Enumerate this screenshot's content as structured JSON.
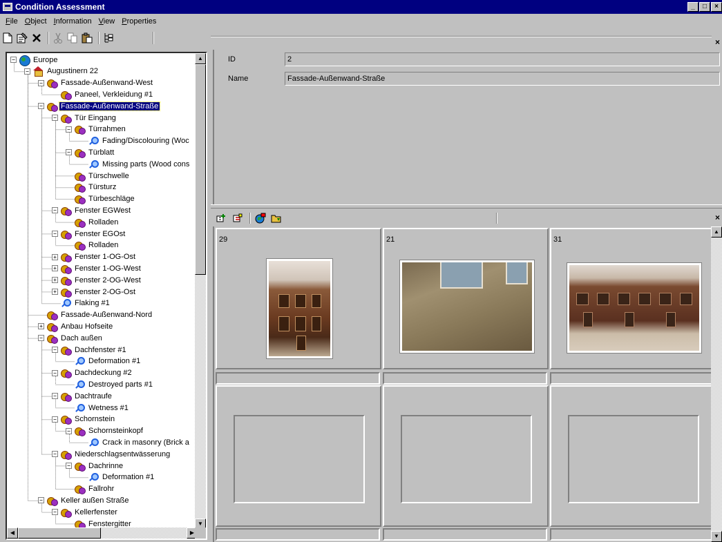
{
  "window": {
    "title": "Condition Assessment",
    "controls": {
      "minimize": "_",
      "maximize": "□",
      "close": "×"
    }
  },
  "menu": {
    "items": [
      {
        "accel": "F",
        "rest": "ile"
      },
      {
        "accel": "O",
        "rest": "bject"
      },
      {
        "accel": "I",
        "rest": "nformation"
      },
      {
        "accel": "V",
        "rest": "iew"
      },
      {
        "accel": "P",
        "rest": "roperties"
      }
    ]
  },
  "toolbar": {
    "icons": [
      "new-document-icon",
      "properties-icon",
      "delete-icon",
      "cut-icon",
      "copy-icon",
      "paste-icon",
      "tree-view-icon"
    ],
    "close_glyph": "×"
  },
  "tree": {
    "nodes": [
      {
        "label": "Europe",
        "depth": 0,
        "expander": "−",
        "icon": "globe-icon"
      },
      {
        "label": "Augustinern 22",
        "depth": 1,
        "expander": "−",
        "icon": "house-icon"
      },
      {
        "label": "Fassade-Außenwand-West",
        "depth": 2,
        "expander": "−",
        "icon": "component-icon"
      },
      {
        "label": "Paneel, Verkleidung #1",
        "depth": 3,
        "expander": "",
        "icon": "component-icon"
      },
      {
        "label": "Fassade-Außenwand-Straße",
        "depth": 2,
        "expander": "−",
        "icon": "component-icon",
        "selected": true
      },
      {
        "label": "Tür Eingang",
        "depth": 3,
        "expander": "−",
        "icon": "component-icon"
      },
      {
        "label": "Türrahmen",
        "depth": 4,
        "expander": "−",
        "icon": "component-icon"
      },
      {
        "label": "Fading/Discolouring (Woc",
        "depth": 5,
        "expander": "",
        "icon": "damage-icon"
      },
      {
        "label": "Türblatt",
        "depth": 4,
        "expander": "−",
        "icon": "component-icon"
      },
      {
        "label": "Missing parts (Wood cons",
        "depth": 5,
        "expander": "",
        "icon": "damage-icon"
      },
      {
        "label": "Türschwelle",
        "depth": 4,
        "expander": "",
        "icon": "component-icon"
      },
      {
        "label": "Türsturz",
        "depth": 4,
        "expander": "",
        "icon": "component-icon"
      },
      {
        "label": "Türbeschläge",
        "depth": 4,
        "expander": "",
        "icon": "component-icon"
      },
      {
        "label": "Fenster EGWest",
        "depth": 3,
        "expander": "−",
        "icon": "component-icon"
      },
      {
        "label": "Rolladen",
        "depth": 4,
        "expander": "",
        "icon": "component-icon"
      },
      {
        "label": "Fenster EGOst",
        "depth": 3,
        "expander": "−",
        "icon": "component-icon"
      },
      {
        "label": "Rolladen",
        "depth": 4,
        "expander": "",
        "icon": "component-icon"
      },
      {
        "label": "Fenster 1-OG-Ost",
        "depth": 3,
        "expander": "+",
        "icon": "component-icon"
      },
      {
        "label": "Fenster 1-OG-West",
        "depth": 3,
        "expander": "+",
        "icon": "component-icon"
      },
      {
        "label": "Fenster 2-OG-West",
        "depth": 3,
        "expander": "+",
        "icon": "component-icon"
      },
      {
        "label": "Fenster 2-OG-Ost",
        "depth": 3,
        "expander": "+",
        "icon": "component-icon"
      },
      {
        "label": "Flaking #1",
        "depth": 3,
        "expander": "",
        "icon": "damage-icon"
      },
      {
        "label": "Fassade-Außenwand-Nord",
        "depth": 2,
        "expander": "",
        "icon": "component-icon"
      },
      {
        "label": "Anbau Hofseite",
        "depth": 2,
        "expander": "+",
        "icon": "component-icon"
      },
      {
        "label": "Dach außen",
        "depth": 2,
        "expander": "−",
        "icon": "component-icon"
      },
      {
        "label": "Dachfenster #1",
        "depth": 3,
        "expander": "−",
        "icon": "component-icon"
      },
      {
        "label": "Deformation #1",
        "depth": 4,
        "expander": "",
        "icon": "damage-icon"
      },
      {
        "label": "Dachdeckung #2",
        "depth": 3,
        "expander": "−",
        "icon": "component-icon"
      },
      {
        "label": "Destroyed parts #1",
        "depth": 4,
        "expander": "",
        "icon": "damage-icon"
      },
      {
        "label": "Dachtraufe",
        "depth": 3,
        "expander": "−",
        "icon": "component-icon"
      },
      {
        "label": "Wetness #1",
        "depth": 4,
        "expander": "",
        "icon": "damage-icon"
      },
      {
        "label": "Schornstein",
        "depth": 3,
        "expander": "−",
        "icon": "component-icon"
      },
      {
        "label": "Schornsteinkopf",
        "depth": 4,
        "expander": "−",
        "icon": "component-icon"
      },
      {
        "label": "Crack in masonry (Brick a",
        "depth": 5,
        "expander": "",
        "icon": "damage-icon"
      },
      {
        "label": "Niederschlagsentwässerung",
        "depth": 3,
        "expander": "−",
        "icon": "component-icon"
      },
      {
        "label": "Dachrinne",
        "depth": 4,
        "expander": "−",
        "icon": "component-icon"
      },
      {
        "label": "Deformation #1",
        "depth": 5,
        "expander": "",
        "icon": "damage-icon"
      },
      {
        "label": "Fallrohr",
        "depth": 4,
        "expander": "",
        "icon": "component-icon"
      },
      {
        "label": "Keller außen Straße",
        "depth": 2,
        "expander": "−",
        "icon": "component-icon"
      },
      {
        "label": "Kellerfenster",
        "depth": 3,
        "expander": "−",
        "icon": "component-icon"
      },
      {
        "label": "Fenstergitter",
        "depth": 4,
        "expander": "",
        "icon": "component-icon"
      }
    ]
  },
  "properties": {
    "fields": [
      {
        "label": "ID",
        "value": "2"
      },
      {
        "label": "Name",
        "value": "Fassade-Außenwand-Straße"
      }
    ],
    "close_glyph": "×"
  },
  "gallery": {
    "toolbar_icons": [
      "add-photo-icon",
      "remove-photo-icon",
      "globe-link-icon",
      "open-photo-icon"
    ],
    "cells": [
      {
        "number": "29",
        "has_photo": true
      },
      {
        "number": "21",
        "has_photo": true
      },
      {
        "number": "31",
        "has_photo": true
      },
      {
        "number": "",
        "has_photo": false
      },
      {
        "number": "",
        "has_photo": false
      },
      {
        "number": "",
        "has_photo": false
      }
    ],
    "close_glyph": "×"
  },
  "colors": {
    "titlebar": "#000080",
    "face": "#c0c0c0",
    "selection": "#000080"
  }
}
